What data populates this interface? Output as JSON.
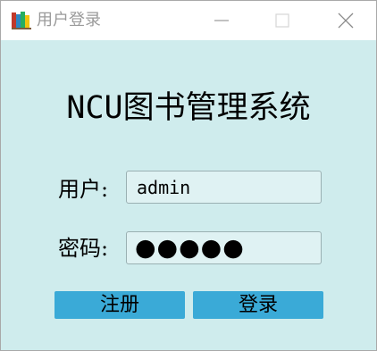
{
  "window": {
    "title": "用户登录",
    "icon": "books-icon",
    "controls": {
      "minimize_icon": "minimize-icon",
      "maximize_icon": "maximize-icon",
      "close_icon": "close-icon"
    }
  },
  "main": {
    "system_title": "NCU图书管理系统",
    "username": {
      "label": "用户:",
      "value": "admin"
    },
    "password": {
      "label": "密码:",
      "masked_value": "●●●●●"
    },
    "buttons": {
      "register_label": "注册",
      "login_label": "登录"
    }
  },
  "colors": {
    "background": "#cfeced",
    "button": "#3aaad7",
    "titlebar": "#ffffff"
  }
}
